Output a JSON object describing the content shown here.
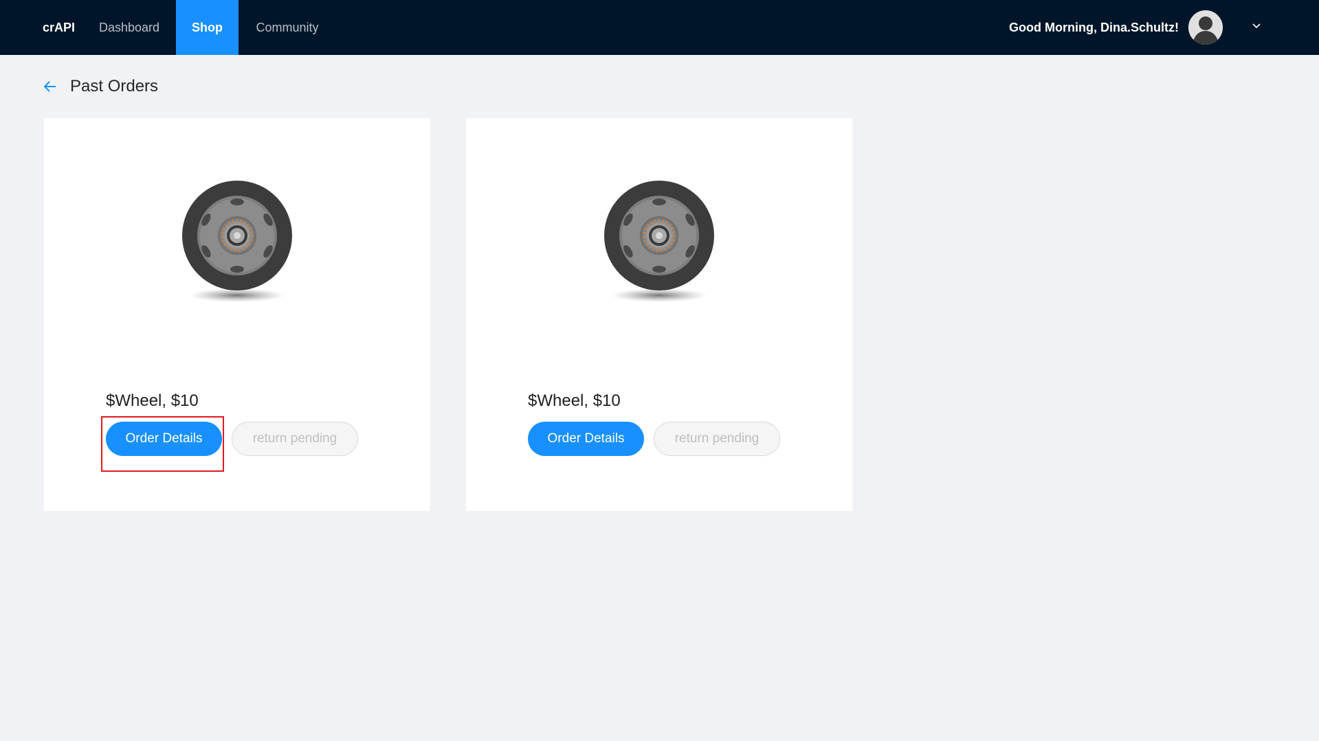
{
  "header": {
    "brand": "crAPI",
    "nav": [
      {
        "label": "Dashboard"
      },
      {
        "label": "Shop"
      },
      {
        "label": "Community"
      }
    ],
    "greeting": "Good Morning, Dina.Schultz!"
  },
  "page": {
    "title": "Past Orders"
  },
  "orders": [
    {
      "title": "$Wheel, $10",
      "details_label": "Order Details",
      "status_label": "return pending"
    },
    {
      "title": "$Wheel, $10",
      "details_label": "Order Details",
      "status_label": "return pending"
    }
  ],
  "colors": {
    "header_bg": "#001529",
    "accent": "#1890ff",
    "page_bg": "#f0f2f5",
    "highlight": "#e0191f"
  }
}
